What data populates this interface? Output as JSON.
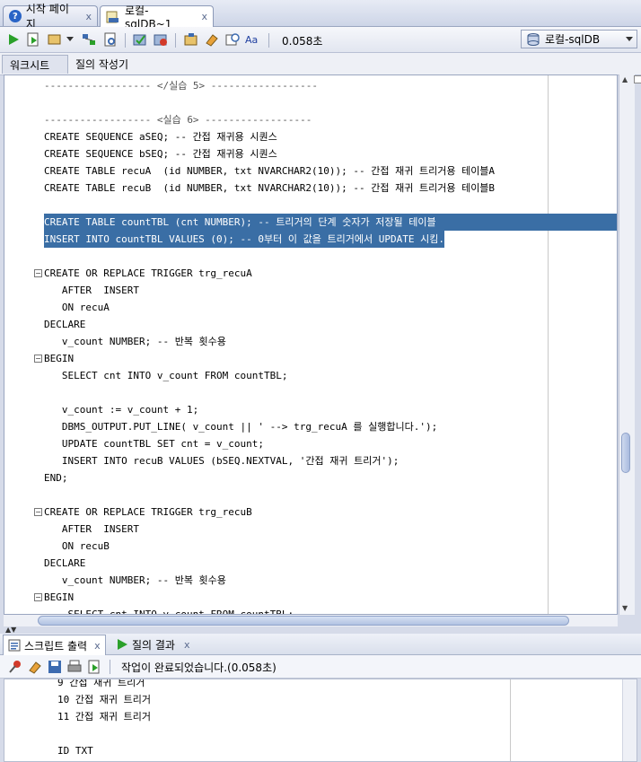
{
  "tabs": [
    {
      "label": "시작 페이지",
      "close": "x"
    },
    {
      "label": "로컬-sqlDB~1",
      "close": "x"
    }
  ],
  "toolbar": {
    "timing": "0.058초",
    "connection": "로컬-sqlDB"
  },
  "subtabs": [
    "워크시트",
    "질의 작성기"
  ],
  "code": [
    "------------------ </실습 5> ------------------",
    "",
    "------------------ <실습 6> ------------------",
    "CREATE SEQUENCE aSEQ; -- 간접 재귀용 시퀀스",
    "CREATE SEQUENCE bSEQ; -- 간접 재귀용 시퀀스",
    "CREATE TABLE recuA  (id NUMBER, txt NVARCHAR2(10)); -- 간접 재귀 트리거용 테이블A",
    "CREATE TABLE recuB  (id NUMBER, txt NVARCHAR2(10)); -- 간접 재귀 트리거용 테이블B",
    "",
    "CREATE TABLE countTBL (cnt NUMBER); -- 트리거의 단계 숫자가 저장될 테이블",
    "INSERT INTO countTBL VALUES (0); -- 0부터 이 값을 트리거에서 UPDATE 시킴.",
    "",
    "CREATE OR REPLACE TRIGGER trg_recuA",
    "   AFTER  INSERT",
    "   ON recuA",
    "DECLARE",
    "   v_count NUMBER; -- 반복 횟수용",
    "BEGIN",
    "   SELECT cnt INTO v_count FROM countTBL;",
    "",
    "   v_count := v_count + 1;",
    "   DBMS_OUTPUT.PUT_LINE( v_count || ' --> trg_recuA 를 실행합니다.');",
    "   UPDATE countTBL SET cnt = v_count;",
    "   INSERT INTO recuB VALUES (bSEQ.NEXTVAL, '간접 재귀 트리거');",
    "END;",
    "",
    "CREATE OR REPLACE TRIGGER trg_recuB",
    "   AFTER  INSERT",
    "   ON recuB",
    "DECLARE",
    "   v_count NUMBER; -- 반복 횟수용",
    "BEGIN",
    "    SELECT cnt INTO v_count FROM countTBL;"
  ],
  "bottom_tabs": [
    {
      "label": "스크립트 출력",
      "close": "x"
    },
    {
      "label": "질의 결과",
      "close": "x"
    }
  ],
  "status_message": "작업이 완료되었습니다.(0.058초)",
  "output": [
    {
      "num": "9",
      "text": "간접 재귀 트리거"
    },
    {
      "num": "10",
      "text": "간접 재귀 트리거"
    },
    {
      "num": "11",
      "text": "간접 재귀 트리거"
    },
    {
      "num": "",
      "text": ""
    },
    {
      "num": "ID",
      "text": "TXT"
    }
  ]
}
